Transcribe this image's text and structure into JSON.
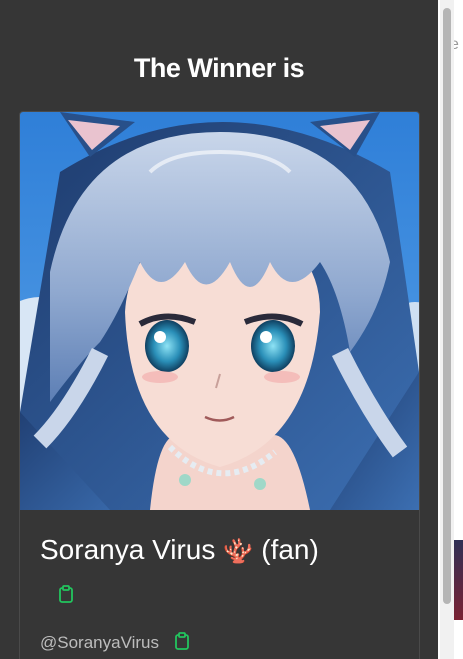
{
  "header": {
    "title": "The Winner is"
  },
  "winner": {
    "name": "Soranya Virus",
    "emoji": "🪸",
    "tag": "(fan)",
    "handle": "@SoranyaVirus",
    "image_icon": "anime-avatar"
  },
  "background_peek": {
    "char": "e"
  },
  "colors": {
    "panel_bg": "#363636",
    "title_text": "#ffffff",
    "copy_icon": "#22c55e",
    "handle_text": "#bdbdbd"
  }
}
